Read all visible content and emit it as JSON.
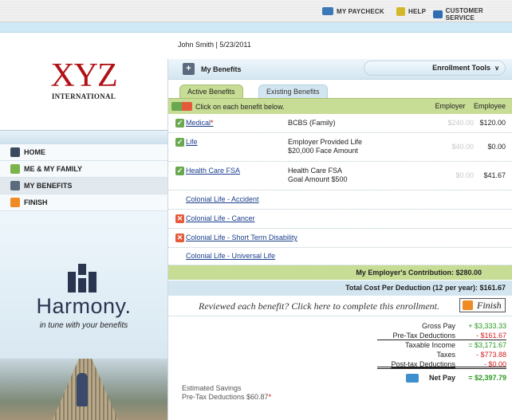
{
  "topnav": {
    "paycheck": "MY PAYCHECK",
    "help": "HELP",
    "customer_service": "CUSTOMER SERVICE"
  },
  "logo": {
    "main": "XYZ",
    "sub": "INTERNATIONAL"
  },
  "nav": {
    "items": [
      {
        "label": "HOME",
        "icon": "house-icon"
      },
      {
        "label": "ME & MY FAMILY",
        "icon": "family-icon"
      },
      {
        "label": "MY BENEFITS",
        "icon": "benefits-icon"
      },
      {
        "label": "FINISH",
        "icon": "finish-icon"
      }
    ]
  },
  "promo": {
    "brand": "Harmony.",
    "tagline": "in tune with your benefits"
  },
  "user_line": "John Smith | 5/23/2011",
  "panel": {
    "title": "My Benefits",
    "tools": "Enrollment Tools"
  },
  "tabs": {
    "active": "Active Benefits",
    "existing": "Existing Benefits"
  },
  "instruction": "Click on each benefit below.",
  "columns": {
    "employer": "Employer",
    "employee": "Employee"
  },
  "benefits": [
    {
      "name": "Medical",
      "required": "*",
      "desc1": "BCBS (Family)",
      "desc2": "",
      "employer": "$240.00",
      "employee": "$120.00",
      "status": "check"
    },
    {
      "name": "Life",
      "required": "",
      "desc1": "Employer Provided Life",
      "desc2": "$20,000 Face Amount",
      "employer": "$40.00",
      "employee": "$0.00",
      "status": "check"
    },
    {
      "name": "Health Care FSA",
      "required": "",
      "desc1": "Health Care FSA",
      "desc2": "Goal Amount $500",
      "employer": "$0.00",
      "employee": "$41.67",
      "status": "check"
    },
    {
      "name": "Colonial Life - Accident",
      "required": "",
      "desc1": "",
      "desc2": "",
      "employer": "",
      "employee": "",
      "status": "none"
    },
    {
      "name": "Colonial Life - Cancer",
      "required": "",
      "desc1": "",
      "desc2": "",
      "employer": "",
      "employee": "",
      "status": "x"
    },
    {
      "name": "Colonial Life - Short Term Disability",
      "required": "",
      "desc1": "",
      "desc2": "",
      "employer": "",
      "employee": "",
      "status": "x"
    },
    {
      "name": "Colonial Life - Universal Life",
      "required": "",
      "desc1": "",
      "desc2": "",
      "employer": "",
      "employee": "",
      "status": "none"
    }
  ],
  "contribution": "My Employer's Contribution: $280.00",
  "total_cost": "Total Cost Per Deduction (12 per year): $161.67",
  "review": {
    "text": "Reviewed each benefit? Click here to complete this enrollment.",
    "button": "Finish"
  },
  "estimate": {
    "line1": "Estimated Savings",
    "line2": "Pre-Tax Deductions $60.87",
    "mark": "*"
  },
  "summary": {
    "gross_label": "Gross Pay",
    "gross": "+ $3,333.33",
    "pretax_label": "Pre-Tax Deductions",
    "pretax": "- $161.67",
    "taxable_label": "Taxable Income",
    "taxable": "= $3,171.67",
    "taxes_label": "Taxes",
    "taxes": "- $773.88",
    "posttax_label": "Post-tax Deductions",
    "posttax": "- $0.00",
    "net_label": "Net Pay",
    "net": "= $2,397.79"
  },
  "colors": {
    "green_bar": "#c7dc94",
    "link": "#1c3f8c",
    "accent_red": "#b11116"
  }
}
